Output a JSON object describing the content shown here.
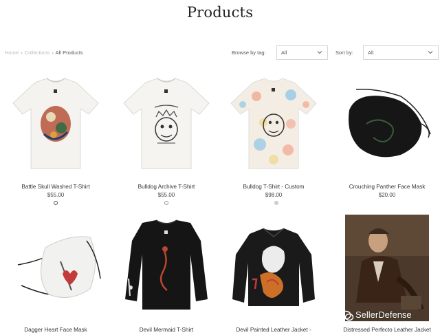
{
  "page": {
    "title": "Products"
  },
  "breadcrumb": {
    "home": "Home",
    "sep1": "›",
    "collections": "Collections",
    "sep2": "›",
    "current": "All Products"
  },
  "filters": {
    "browse_label": "Browse by tag:",
    "browse_value": "All",
    "sort_label": "Sort by:",
    "sort_value": "All"
  },
  "products": [
    {
      "name": "Battle Skull Washed T-Shirt",
      "price": "$55.00"
    },
    {
      "name": "Bulldog Archive T-Shirt",
      "price": "$55.00"
    },
    {
      "name": "Bulldog T-Shirt - Custom",
      "price": "$98.00"
    },
    {
      "name": "Crouching Panther Face Mask",
      "price": "$20.00"
    },
    {
      "name": "Dagger Heart Face Mask",
      "price": ""
    },
    {
      "name": "Devil Mermaid T-Shirt",
      "price": ""
    },
    {
      "name": "Devil Painted Leather Jacket -",
      "price": ""
    },
    {
      "name": "Distressed Perfecto Leather Jacket",
      "price": ""
    }
  ],
  "watermark": {
    "text": "SellerDefense"
  },
  "colors": {
    "swatch_white": "#ffffff",
    "swatch_gray": "#cccccc",
    "leather": "#1a1a1a"
  }
}
